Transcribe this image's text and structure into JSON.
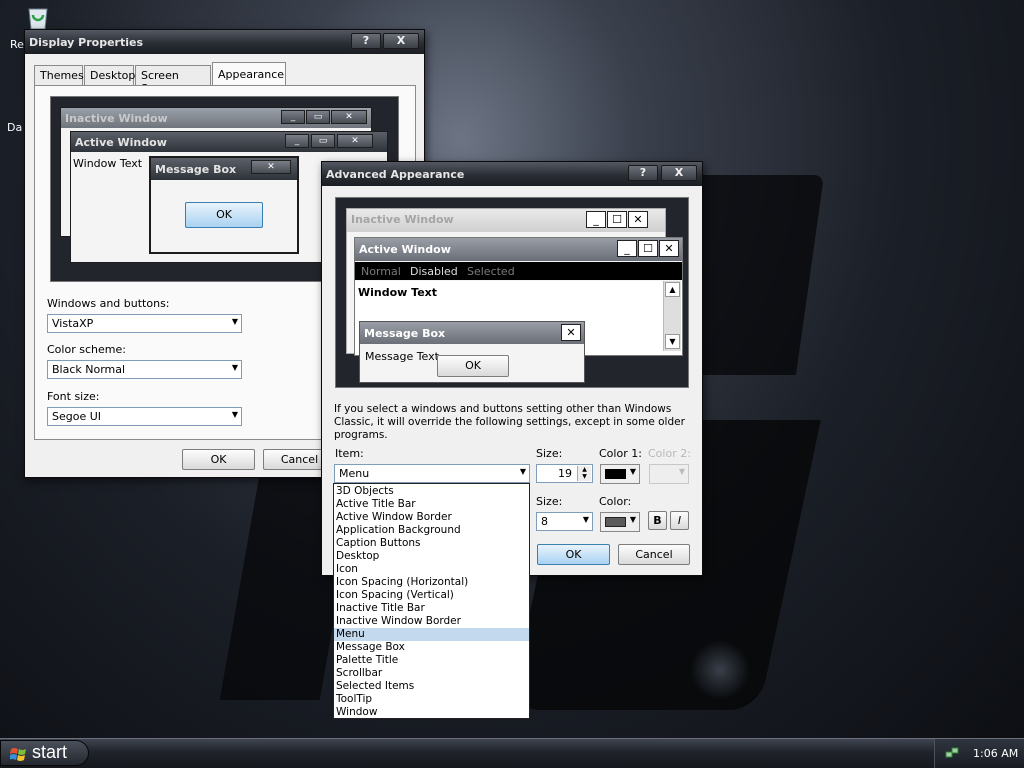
{
  "desktop": {
    "icon_labels": [
      "Re",
      "Da"
    ]
  },
  "display_properties": {
    "title": "Display Properties",
    "help_btn": "?",
    "close_btn": "X",
    "tabs": [
      "Themes",
      "Desktop",
      "Screen Saver",
      "Appearance"
    ],
    "active_tab": "Appearance",
    "preview": {
      "inactive_title": "Inactive Window",
      "active_title": "Active Window",
      "window_text": "Window Text",
      "msgbox_title": "Message Box",
      "ok": "OK"
    },
    "windows_buttons_label": "Windows and buttons:",
    "windows_buttons_value": "VistaXP",
    "color_scheme_label": "Color scheme:",
    "color_scheme_value": "Black Normal",
    "font_size_label": "Font size:",
    "font_size_value": "Segoe UI",
    "ok": "OK",
    "cancel": "Cancel"
  },
  "advanced_appearance": {
    "title": "Advanced Appearance",
    "help_btn": "?",
    "close_btn": "X",
    "preview": {
      "inactive_title": "Inactive Window",
      "active_title": "Active Window",
      "menu_items": [
        "Normal",
        "Disabled",
        "Selected"
      ],
      "window_text": "Window Text",
      "msgbox_title": "Message Box",
      "msgbox_text": "Message Text",
      "ok": "OK"
    },
    "note": "If you select a windows and buttons setting other than Windows Classic, it will override the following settings, except in some older programs.",
    "item_label": "Item:",
    "item_value": "Menu",
    "size_label": "Size:",
    "size_value": "19",
    "color1_label": "Color 1:",
    "color2_label": "Color 2:",
    "font_size_label": "Size:",
    "font_size_value": "8",
    "font_color_label": "Color:",
    "bold_label": "B",
    "italic_label": "I",
    "ok": "OK",
    "cancel": "Cancel",
    "color1_hex": "#000000",
    "font_color_hex": "#5a5a5a"
  },
  "item_list": {
    "items": [
      "3D Objects",
      "Active Title Bar",
      "Active Window Border",
      "Application Background",
      "Caption Buttons",
      "Desktop",
      "Icon",
      "Icon Spacing (Horizontal)",
      "Icon Spacing (Vertical)",
      "Inactive Title Bar",
      "Inactive Window Border",
      "Menu",
      "Message Box",
      "Palette Title",
      "Scrollbar",
      "Selected Items",
      "ToolTip",
      "Window"
    ],
    "selected_index": 11
  },
  "taskbar": {
    "start_label": "start",
    "clock": "1:06 AM"
  },
  "colors": {
    "title_bar": "#2a2e35",
    "selection": "#c3d9ee",
    "focus_button": "#a9d2f1"
  }
}
